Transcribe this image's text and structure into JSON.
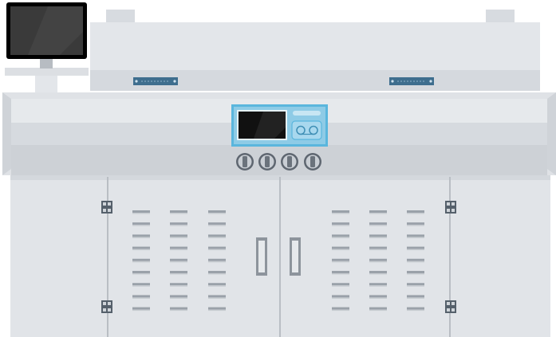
{
  "machine": {
    "colors": {
      "body_light": "#e1e4e8",
      "body_mid": "#d2d6db",
      "body_dark": "#c4c9ce",
      "panel_blue": "#8ecbe6",
      "panel_blue_border": "#5ab6dd",
      "screen_black": "#111111",
      "knob_dark": "#5e6670",
      "hinge_dark": "#55606b",
      "plate_blue": "#3e6e8e"
    },
    "icons": {
      "monitor": "monitor-icon",
      "control_screen": "display-icon",
      "knob": "knob-icon",
      "hinge": "hinge-icon",
      "handle": "door-handle-icon",
      "vent": "vent-grille-icon"
    },
    "knob_count": 4,
    "vent_rows_per_column": 9,
    "vent_columns_per_door": 3
  }
}
